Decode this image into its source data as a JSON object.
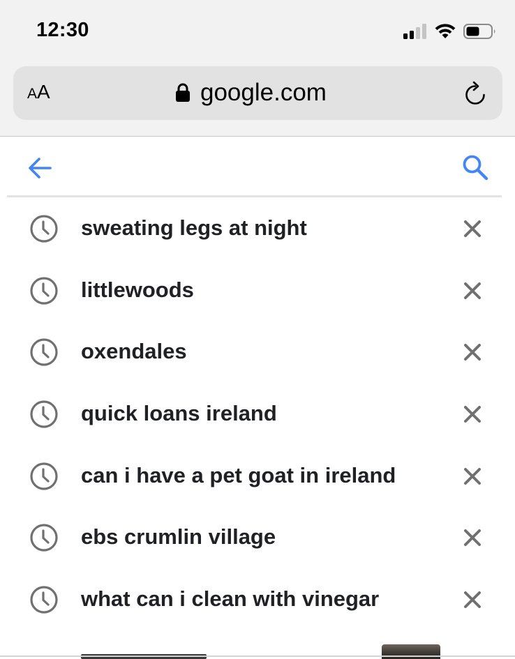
{
  "status_bar": {
    "time": "12:30"
  },
  "browser": {
    "text_size_small": "A",
    "text_size_large": "A",
    "url": "google.com"
  },
  "search": {
    "query": "",
    "suggestions": [
      {
        "text": "sweating legs at night"
      },
      {
        "text": "littlewoods"
      },
      {
        "text": "oxendales"
      },
      {
        "text": "quick loans ireland"
      },
      {
        "text": "can i have a pet goat in ireland"
      },
      {
        "text": "ebs crumlin village"
      },
      {
        "text": "what can i clean with vinegar"
      }
    ]
  },
  "icons": {
    "signal": "cellular-signal-icon",
    "wifi": "wifi-icon",
    "battery": "battery-icon",
    "lock": "lock-icon",
    "reload": "reload-icon",
    "back": "back-arrow-icon",
    "search": "search-icon",
    "history": "history-clock-icon",
    "remove": "close-icon"
  },
  "colors": {
    "google_blue": "#4285f4",
    "suggestion_text": "#202124",
    "icon_gray": "#707070"
  }
}
